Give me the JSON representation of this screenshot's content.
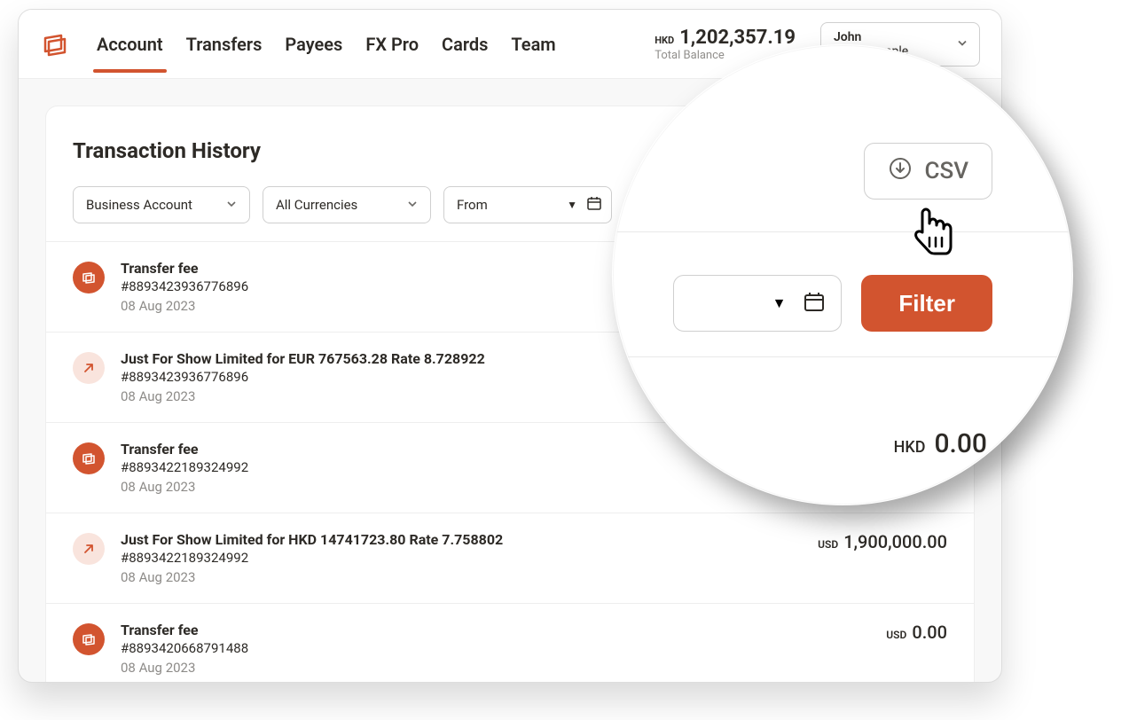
{
  "nav": {
    "items": [
      "Account",
      "Transfers",
      "Payees",
      "FX Pro",
      "Cards",
      "Team"
    ],
    "active": 0
  },
  "balance": {
    "currency": "HKD",
    "amount": "1,202,357.19",
    "label": "Total Balance"
  },
  "user": {
    "name": "John",
    "company": "Just Example"
  },
  "panel": {
    "title": "Transaction History"
  },
  "filters": {
    "account": "Business Account",
    "currency": "All Currencies",
    "from": "From",
    "filter_label": "Filter"
  },
  "csv": {
    "label": "CSV"
  },
  "magnifier": {
    "filter_label": "Filter",
    "amount_ccy": "HKD",
    "amount_val": "0.00"
  },
  "transactions": [
    {
      "type": "fee",
      "title": "Transfer fee",
      "ref": "#8893423936776896",
      "date": "08 Aug 2023",
      "amount_ccy": "",
      "amount_val": ""
    },
    {
      "type": "out",
      "title": "Just For Show Limited for EUR 767563.28 Rate 8.728922",
      "ref": "#8893423936776896",
      "date": "08 Aug 2023",
      "amount_ccy": "",
      "amount_val": ""
    },
    {
      "type": "fee",
      "title": "Transfer fee",
      "ref": "#8893422189324992",
      "date": "08 Aug 2023",
      "amount_ccy": "",
      "amount_val": ""
    },
    {
      "type": "out",
      "title": "Just For Show Limited for HKD 14741723.80 Rate 7.758802",
      "ref": "#8893422189324992",
      "date": "08 Aug 2023",
      "amount_ccy": "USD",
      "amount_val": "1,900,000.00"
    },
    {
      "type": "fee",
      "title": "Transfer fee",
      "ref": "#8893420668791488",
      "date": "08 Aug 2023",
      "amount_ccy": "USD",
      "amount_val": "0.00"
    }
  ]
}
